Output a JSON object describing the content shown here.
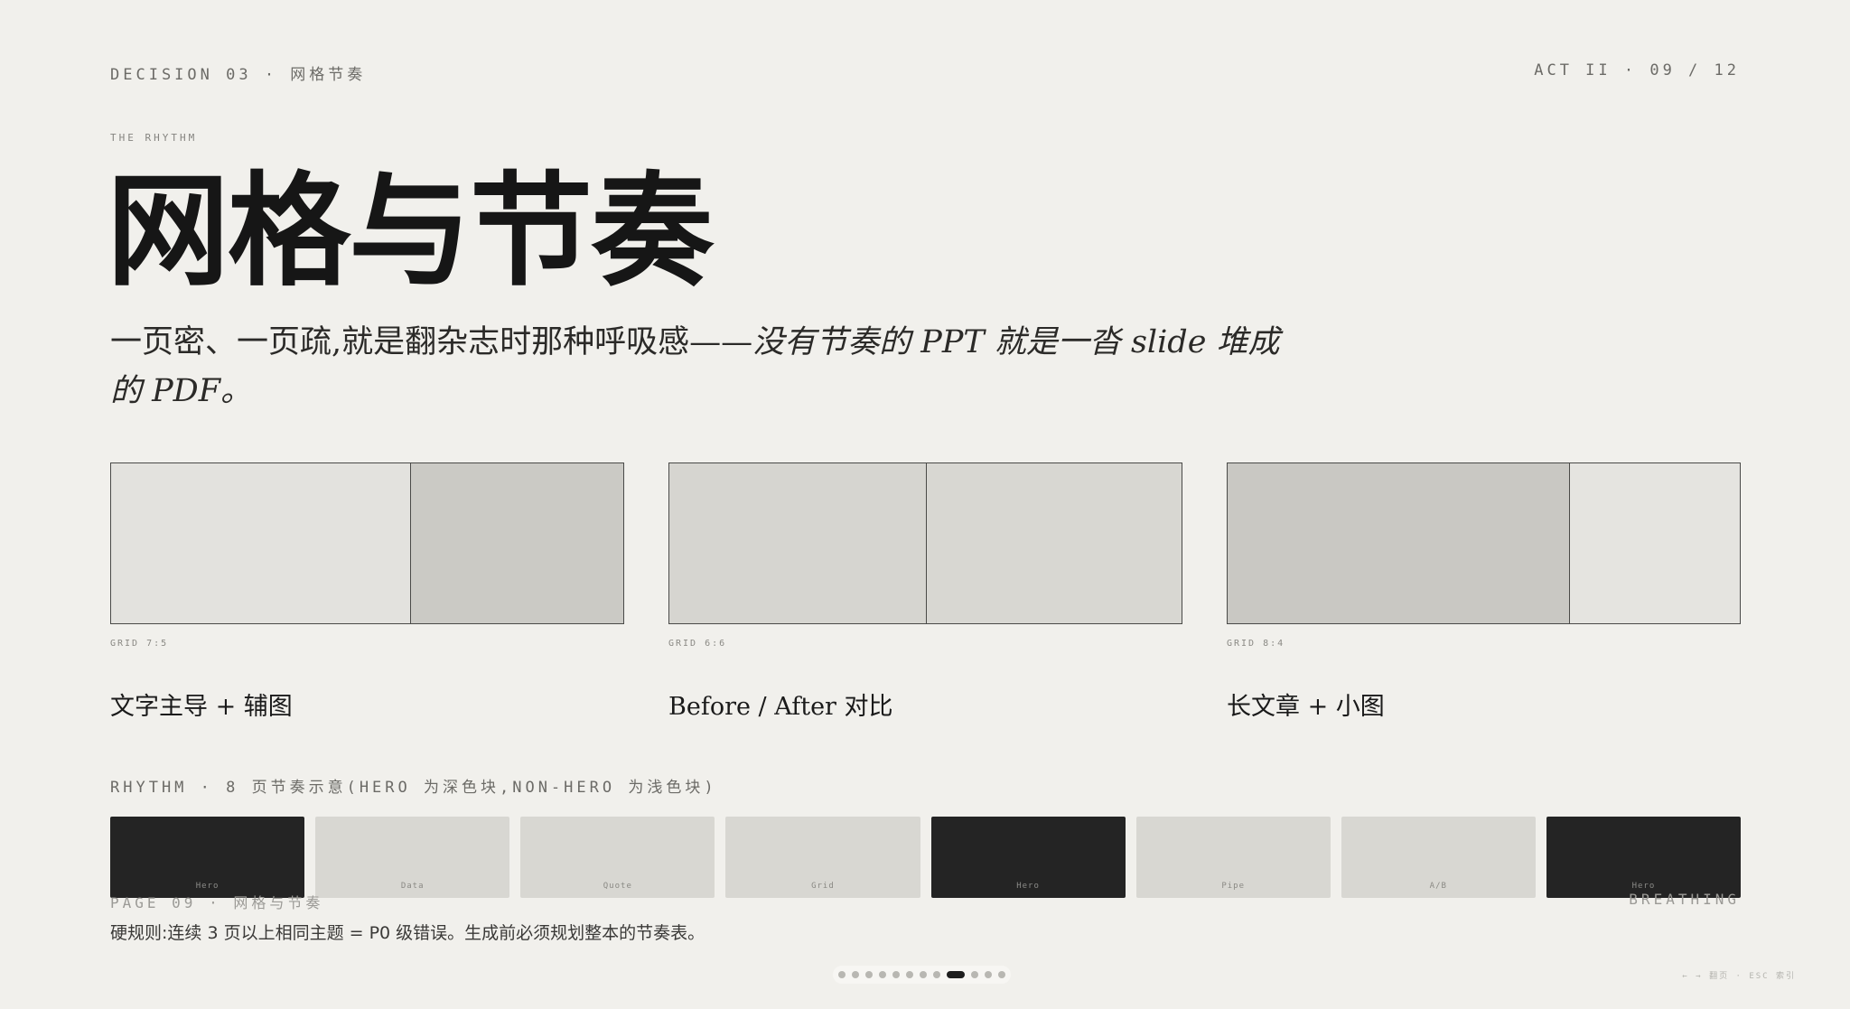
{
  "header": {
    "left": "DECISION 03 · 网格节奏",
    "right": "ACT II · 09 / 12"
  },
  "eyebrow": "THE RHYTHM",
  "title": "网格与节奏",
  "subtitle": {
    "plain": "一页密、一页疏,就是翻杂志时那种呼吸感——",
    "italic": "没有节奏的 PPT 就是一沓 slide 堆成的 PDF。"
  },
  "grids": [
    {
      "label": "GRID 7:5",
      "caption": "文字主导 + 辅图",
      "ratio": [
        7,
        5
      ],
      "shades": [
        "#e3e2de",
        "#cbcac5"
      ]
    },
    {
      "label": "GRID 6:6",
      "caption": "Before / After 对比",
      "ratio": [
        6,
        6
      ],
      "shades": [
        "#d6d5d0",
        "#d8d7d2"
      ]
    },
    {
      "label": "GRID 8:4",
      "caption": "长文章 + 小图",
      "ratio": [
        8,
        4
      ],
      "shades": [
        "#c9c8c3",
        "#e5e4e0"
      ]
    }
  ],
  "rhythm": {
    "label": "RHYTHM · 8 页节奏示意(HERO 为深色块,NON-HERO 为浅色块)",
    "blocks": [
      {
        "name": "Hero",
        "tone": "dark"
      },
      {
        "name": "Data",
        "tone": "light"
      },
      {
        "name": "Quote",
        "tone": "light"
      },
      {
        "name": "Grid",
        "tone": "light"
      },
      {
        "name": "Hero",
        "tone": "dark"
      },
      {
        "name": "Pipe",
        "tone": "light"
      },
      {
        "name": "A/B",
        "tone": "light"
      },
      {
        "name": "Hero",
        "tone": "dark"
      }
    ]
  },
  "footer": {
    "left": "PAGE 09 · 网格与节奏",
    "right": "BREATHING"
  },
  "rule": "硬规则:连续 3 页以上相同主题 = P0 级错误。生成前必须规划整本的节奏表。",
  "pager": {
    "total": 12,
    "current": 9
  },
  "hint": "← → 翻页 · ESC 索引",
  "colors": {
    "background": "#f1f0ec",
    "ink": "#161616",
    "hero": "#242424",
    "non_hero": "#d8d7d2"
  }
}
